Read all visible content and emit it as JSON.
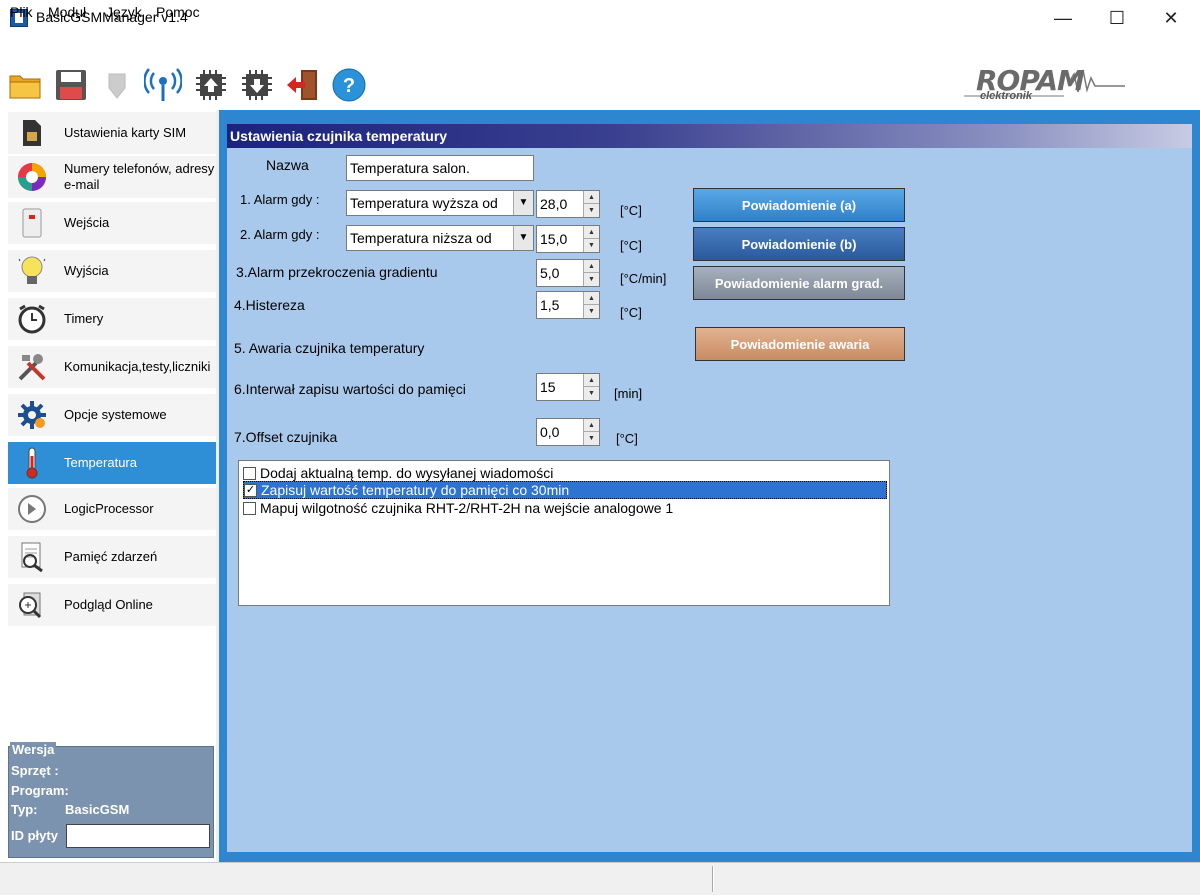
{
  "window": {
    "title": "BasicGSMManager v1.4",
    "controls": {
      "minimize": "—",
      "maximize": "☐",
      "close": "✕"
    }
  },
  "menu": [
    {
      "label": "Plik"
    },
    {
      "label": "Moduł"
    },
    {
      "label": "Język"
    },
    {
      "label": "Pomoc"
    }
  ],
  "toolbar": {
    "icons": [
      "open-folder-icon",
      "save-icon",
      "disabled-module-icon",
      "antenna-icon",
      "chip-upload-icon",
      "chip-download-icon",
      "exit-door-icon",
      "help-icon"
    ],
    "help_label": "?"
  },
  "logo": {
    "brand": "ROPAM",
    "sub": "elektronik"
  },
  "sidebar": {
    "items": [
      {
        "label": "Ustawienia karty SIM",
        "icon": "sim-card-icon"
      },
      {
        "label": "Numery telefonów, adresy e-mail",
        "icon": "contacts-pie-icon"
      },
      {
        "label": "Wejścia",
        "icon": "input-sensor-icon"
      },
      {
        "label": "Wyjścia",
        "icon": "lightbulb-icon"
      },
      {
        "label": "Timery",
        "icon": "alarm-clock-icon"
      },
      {
        "label": "Komunikacja,testy,liczniki",
        "icon": "tools-icon"
      },
      {
        "label": "Opcje systemowe",
        "icon": "gear-icon"
      },
      {
        "label": "Temperatura",
        "icon": "thermometer-icon",
        "active": true
      },
      {
        "label": "LogicProcessor",
        "icon": "logic-processor-icon"
      },
      {
        "label": "Pamięć zdarzeń",
        "icon": "event-log-icon"
      },
      {
        "label": "Podgląd Online",
        "icon": "online-preview-icon"
      }
    ]
  },
  "version": {
    "legend": "Wersja",
    "hardware_label": "Sprzęt :",
    "program_label": "Program:",
    "type_label": "Typ:",
    "type_value": "BasicGSM",
    "board_id_label": "ID płyty",
    "board_id_value": ""
  },
  "panel": {
    "header": "Ustawienia czujnika temperatury",
    "name_label": "Nazwa",
    "name_value": "Temperatura salon.",
    "alarm1": {
      "label": "1. Alarm gdy :",
      "condition": "Temperatura wyższa od",
      "value": "28,0",
      "unit": "[°C]",
      "button": "Powiadomienie (a)"
    },
    "alarm2": {
      "label": "2. Alarm gdy :",
      "condition": "Temperatura niższa od",
      "value": "15,0",
      "unit": "[°C]",
      "button": "Powiadomienie (b)"
    },
    "gradient": {
      "label": "3.Alarm przekroczenia gradientu",
      "value": "5,0",
      "unit": "[°C/min]",
      "button": "Powiadomienie alarm grad."
    },
    "hysteresis": {
      "label": "4.Histereza",
      "value": "1,5",
      "unit": "[°C]"
    },
    "failure": {
      "label": "5. Awaria czujnika temperatury",
      "button": "Powiadomienie awaria"
    },
    "interval": {
      "label": "6.Interwał zapisu wartości do pamięci",
      "value": "15",
      "unit": "[min]"
    },
    "offset": {
      "label": "7.Offset czujnika",
      "value": "0,0",
      "unit": "[°C]"
    },
    "options": [
      {
        "label": "Dodaj aktualną temp. do wysyłanej wiadomości",
        "checked": false,
        "selected": false
      },
      {
        "label": "Zapisuj wartość temperatury do pamięci co 30min",
        "checked": true,
        "selected": true
      },
      {
        "label": "Mapuj wilgotność czujnika RHT-2/RHT-2H na wejście analogowe 1",
        "checked": false,
        "selected": false
      }
    ]
  },
  "colors": {
    "panel_bg": "#a9c9ec",
    "frame_blue": "#2f86d0",
    "active_item": "#2f8fd6",
    "header_navy": "#1a237e"
  }
}
